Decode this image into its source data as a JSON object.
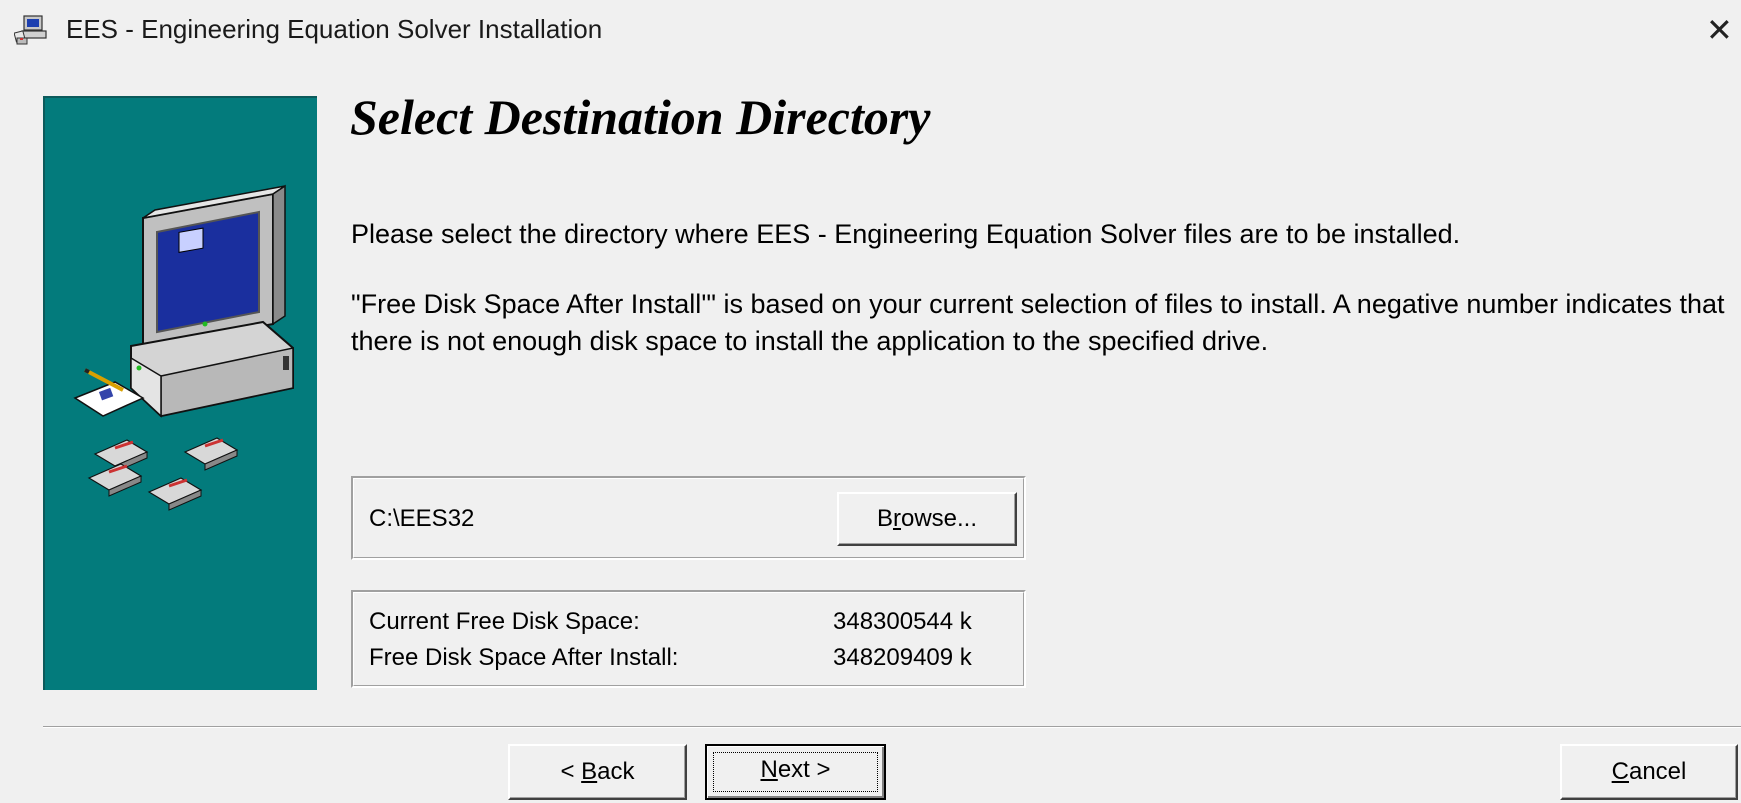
{
  "window": {
    "title": "EES - Engineering Equation Solver Installation",
    "close_glyph": "✕",
    "icon": "installer-computer-icon"
  },
  "page": {
    "heading": "Select Destination Directory",
    "instruction": "Please select the directory where EES - Engineering Equation Solver files are to be installed.",
    "note": "\"Free Disk Space After Install'\" is based on your current selection of files to install.  A negative number indicates that there is not enough disk space to install the application to the specified drive."
  },
  "destination": {
    "path": "C:\\EES32",
    "browse_label": {
      "pre": "B",
      "accel": "r",
      "post": "owse..."
    }
  },
  "disk": {
    "current_label": "Current Free Disk Space:",
    "current_value": "348300544 k",
    "after_label": "Free Disk Space After Install:",
    "after_value": "348209409 k"
  },
  "buttons": {
    "back": {
      "pre": "< ",
      "accel": "B",
      "post": "ack"
    },
    "next": {
      "pre": "",
      "accel": "N",
      "post": "ext >"
    },
    "cancel": {
      "pre": "",
      "accel": "C",
      "post": "ancel"
    }
  },
  "colors": {
    "side_panel": "#037b7c",
    "dialog_bg": "#f0f0f0"
  }
}
